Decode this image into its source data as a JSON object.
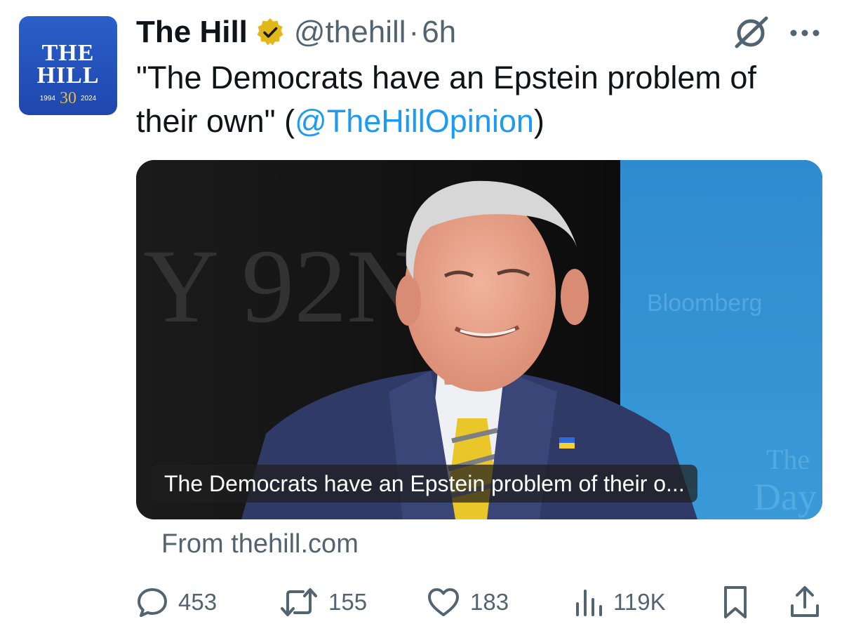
{
  "author": {
    "display_name": "The Hill",
    "handle": "@thehill",
    "separator": "·",
    "time": "6h",
    "avatar": {
      "line1": "THE",
      "line2": "HILL",
      "year_start": "1994",
      "anniversary": "30",
      "year_end": "2024"
    }
  },
  "tweet": {
    "text_before": "\"The Democrats have an Epstein problem of their own\" (",
    "mention": "@TheHillOpinion",
    "text_after": ")"
  },
  "card": {
    "caption": "The Democrats have an Epstein problem of their o...",
    "source": "From thehill.com",
    "image_alt": "photo-of-man-in-suit-smiling-on-stage"
  },
  "actions": {
    "replies": "453",
    "reposts": "155",
    "likes": "183",
    "views": "119K"
  },
  "icons": {
    "verified": "verified-badge-icon",
    "grok": "grok-icon",
    "more": "more-icon",
    "reply": "reply-icon",
    "repost": "repost-icon",
    "like": "heart-icon",
    "views": "views-icon",
    "bookmark": "bookmark-icon",
    "share": "share-icon"
  },
  "colors": {
    "link": "#1d9bf0",
    "secondary_text": "#536471",
    "verified_gold": "#e2b719",
    "avatar_blue": "#2a5fc9"
  }
}
